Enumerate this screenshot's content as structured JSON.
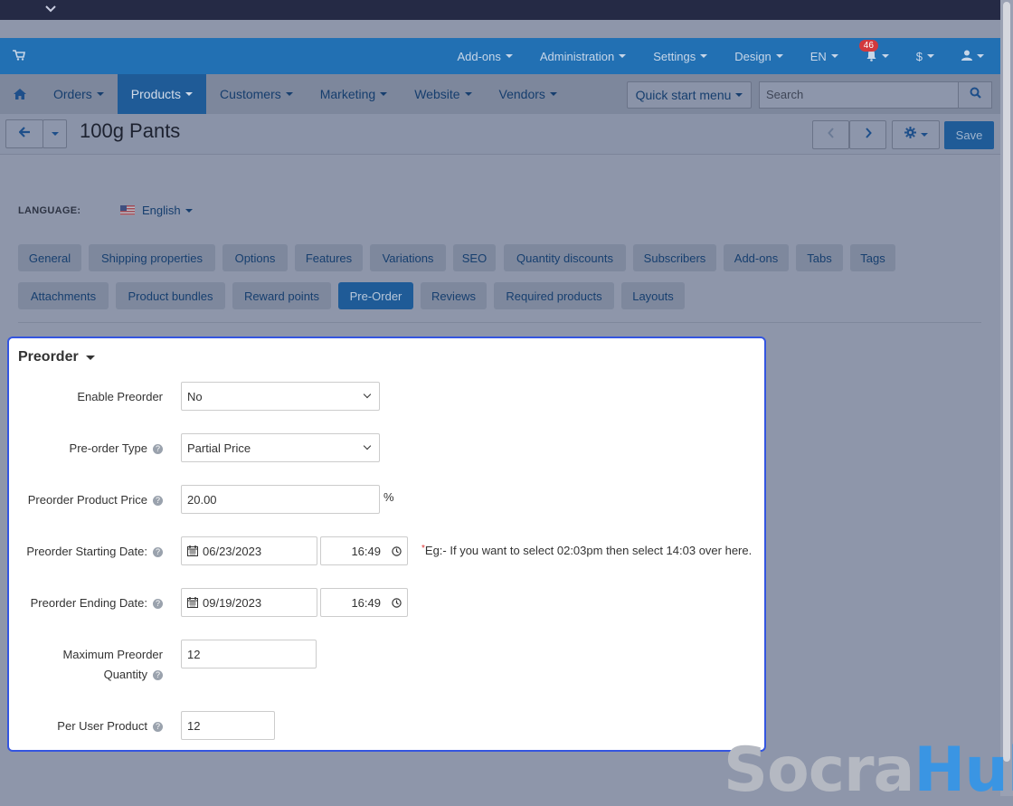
{
  "top_nav": {
    "items": [
      "Add-ons",
      "Administration",
      "Settings",
      "Design",
      "EN"
    ],
    "notifications_count": "46",
    "currency": "$"
  },
  "main_nav": {
    "tabs": [
      "Orders",
      "Products",
      "Customers",
      "Marketing",
      "Website",
      "Vendors"
    ],
    "active": "Products",
    "quick_start": "Quick start menu",
    "search_placeholder": "Search"
  },
  "page": {
    "title": "100g Pants",
    "save_label": "Save"
  },
  "language": {
    "label": "LANGUAGE:",
    "value": "English"
  },
  "product_tabs": {
    "row1": [
      "General",
      "Shipping properties",
      "Options",
      "Features",
      "Variations",
      "SEO",
      "Quantity discounts",
      "Subscribers",
      "Add-ons",
      "Tabs",
      "Tags"
    ],
    "row2": [
      "Attachments",
      "Product bundles",
      "Reward points",
      "Pre-Order",
      "Reviews",
      "Required products",
      "Layouts"
    ],
    "active": "Pre-Order"
  },
  "preorder": {
    "title": "Preorder",
    "enable_label": "Enable Preorder",
    "enable_value": "No",
    "type_label": "Pre-order Type",
    "type_value": "Partial Price",
    "price_label": "Preorder Product Price",
    "price_value": "20.00",
    "price_unit": "%",
    "start_label": "Preorder Starting Date:",
    "start_date": "06/23/2023",
    "start_time": "16:49",
    "hint": "Eg:- If you want to select 02:03pm then select 14:03 over here.",
    "end_label": "Preorder Ending Date:",
    "end_date": "09/19/2023",
    "end_time": "16:49",
    "max_label_1": "Maximum Preorder",
    "max_label_2": "Quantity",
    "max_value": "12",
    "per_user_label": "Per User Product",
    "per_user_value": "12"
  },
  "watermark": {
    "part1": "Socra",
    "part2": "Hub"
  }
}
